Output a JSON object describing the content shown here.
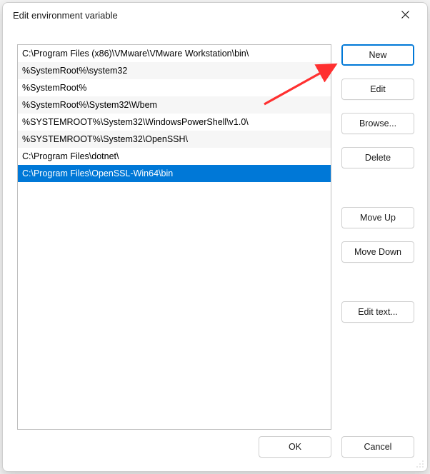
{
  "dialog": {
    "title": "Edit environment variable"
  },
  "list": {
    "items": [
      {
        "value": "C:\\Program Files (x86)\\VMware\\VMware Workstation\\bin\\",
        "selected": false
      },
      {
        "value": "%SystemRoot%\\system32",
        "selected": false
      },
      {
        "value": "%SystemRoot%",
        "selected": false
      },
      {
        "value": "%SystemRoot%\\System32\\Wbem",
        "selected": false
      },
      {
        "value": "%SYSTEMROOT%\\System32\\WindowsPowerShell\\v1.0\\",
        "selected": false
      },
      {
        "value": "%SYSTEMROOT%\\System32\\OpenSSH\\",
        "selected": false
      },
      {
        "value": "C:\\Program Files\\dotnet\\",
        "selected": false
      },
      {
        "value": "C:\\Program Files\\OpenSSL-Win64\\bin",
        "selected": true
      }
    ]
  },
  "buttons": {
    "new_label": "New",
    "edit_label": "Edit",
    "browse_label": "Browse...",
    "delete_label": "Delete",
    "moveup_label": "Move Up",
    "movedown_label": "Move Down",
    "edittext_label": "Edit text...",
    "ok_label": "OK",
    "cancel_label": "Cancel"
  },
  "annotation": {
    "color": "#ff3030"
  }
}
